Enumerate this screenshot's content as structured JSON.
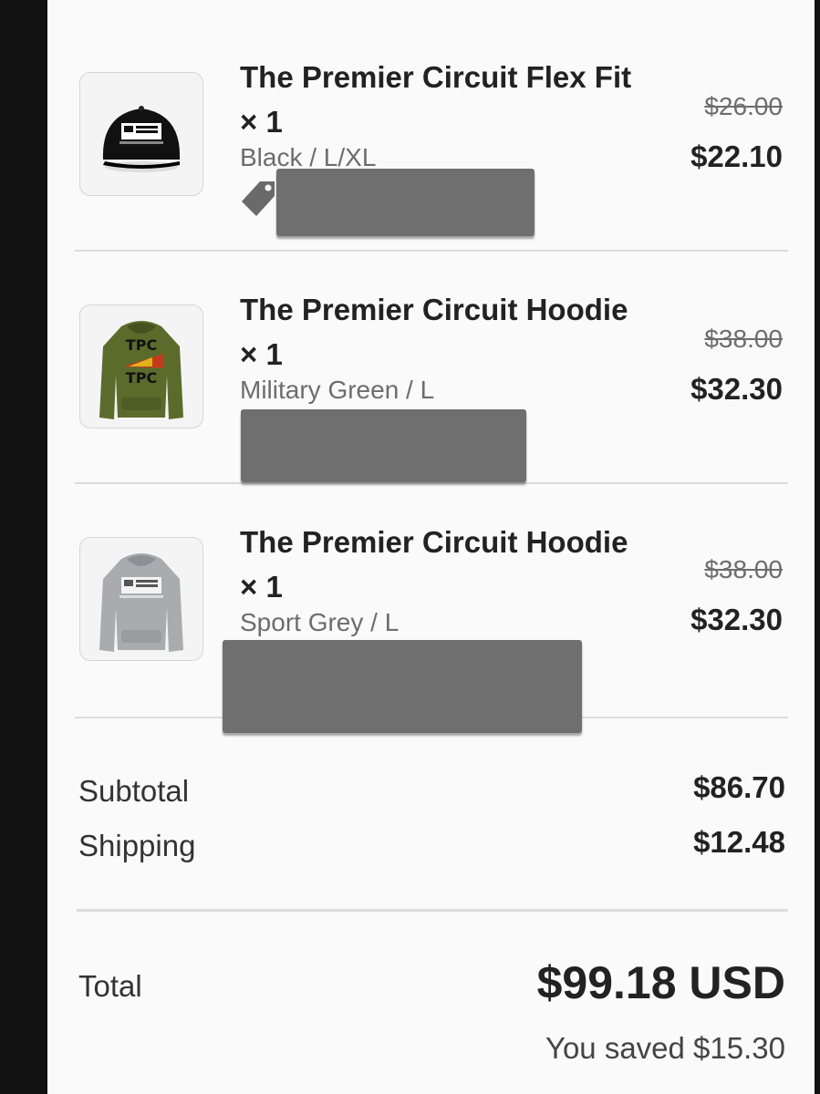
{
  "items": [
    {
      "title": "The Premier Circuit Flex Fit × 1",
      "variant": "Black / L/XL",
      "price_original": "$26.00",
      "price_discounted": "$22.10",
      "image_icon": "black-cap-icon",
      "has_discount_tag": true
    },
    {
      "title": "The Premier Circuit Hoodie × 1",
      "variant": "Military Green / L",
      "price_original": "$38.00",
      "price_discounted": "$32.30",
      "image_icon": "green-hoodie-icon",
      "has_discount_tag": false
    },
    {
      "title": "The Premier Circuit Hoodie × 1",
      "variant": "Sport Grey / L",
      "price_original": "$38.00",
      "price_discounted": "$32.30",
      "image_icon": "grey-hoodie-icon",
      "has_discount_tag": false
    }
  ],
  "summary": {
    "subtotal_label": "Subtotal",
    "subtotal_value": "$86.70",
    "shipping_label": "Shipping",
    "shipping_value": "$12.48",
    "total_label": "Total",
    "total_value": "$99.18 USD",
    "saved_text": "You saved $15.30"
  },
  "colors": {
    "redaction": "#6f6f6f",
    "divider": "#dcdcdc",
    "muted_text": "#6d6d6d"
  }
}
